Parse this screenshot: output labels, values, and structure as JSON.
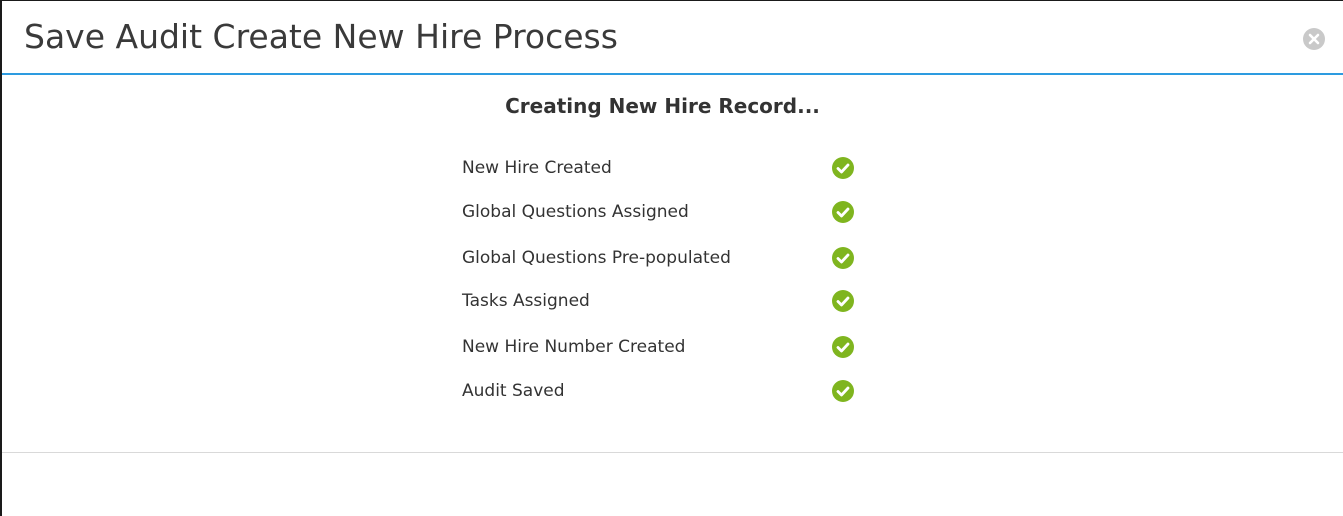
{
  "dialog": {
    "title": "Save Audit Create New Hire Process",
    "close_icon": "close-circle-icon"
  },
  "progress": {
    "heading": "Creating New Hire Record...",
    "steps": [
      {
        "label": "New Hire Created",
        "status": "complete",
        "icon": "check-circle-icon"
      },
      {
        "label": "Global Questions Assigned",
        "status": "complete",
        "icon": "check-circle-icon"
      },
      {
        "label": "Global Questions Pre-populated",
        "status": "complete",
        "icon": "check-circle-icon"
      },
      {
        "label": "Tasks Assigned",
        "status": "complete",
        "icon": "check-circle-icon"
      },
      {
        "label": "New Hire Number Created",
        "status": "complete",
        "icon": "check-circle-icon"
      },
      {
        "label": "Audit Saved",
        "status": "complete",
        "icon": "check-circle-icon"
      }
    ]
  },
  "colors": {
    "accent": "#2d9be0",
    "success": "#7fb51f"
  }
}
